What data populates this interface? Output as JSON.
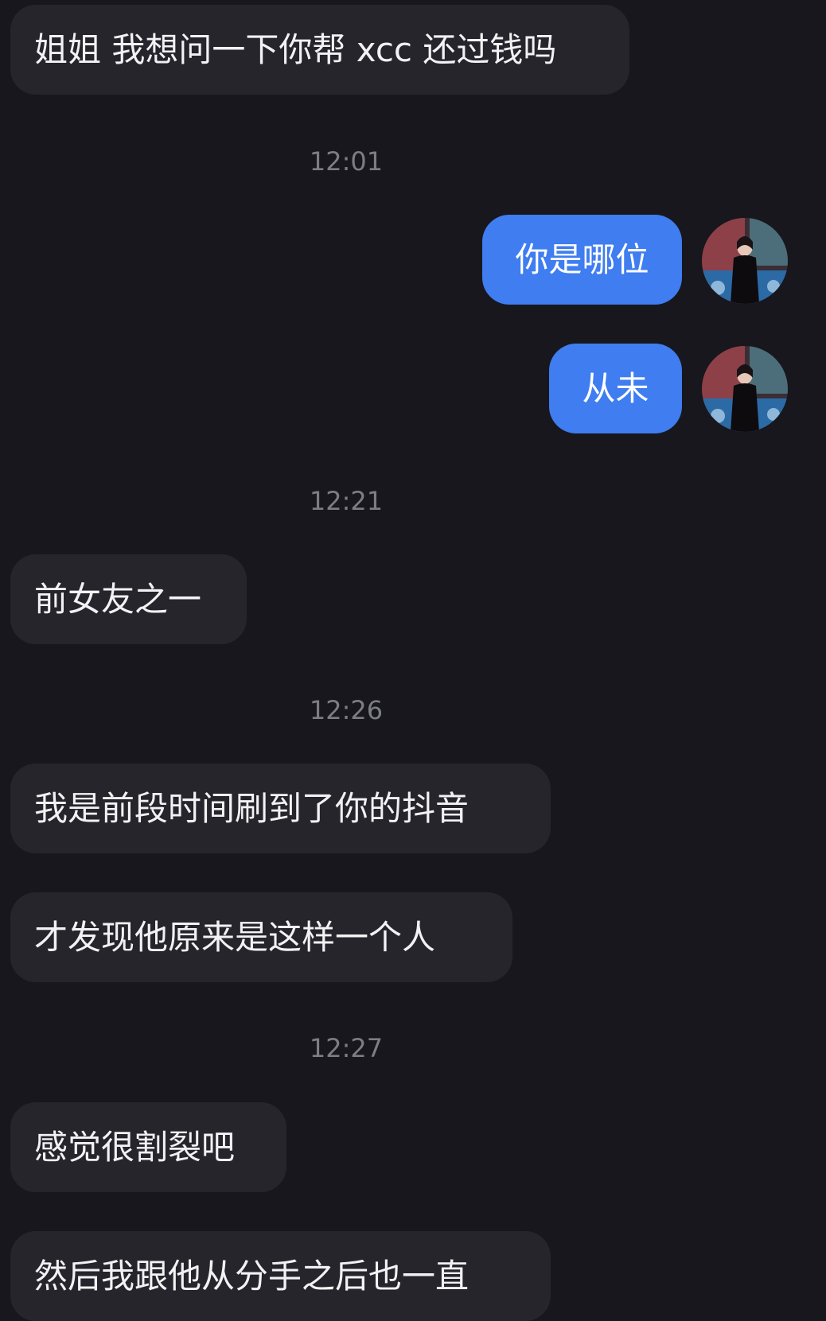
{
  "conversation": {
    "messages": [
      {
        "sender": "contact",
        "text": "姐姐 我想问一下你帮 xcc 还过钱吗"
      },
      {
        "type": "timestamp",
        "text": "12:01"
      },
      {
        "sender": "me",
        "text": "你是哪位"
      },
      {
        "sender": "me",
        "text": "从未"
      },
      {
        "type": "timestamp",
        "text": "12:21"
      },
      {
        "sender": "contact",
        "text": "前女友之一"
      },
      {
        "type": "timestamp",
        "text": "12:26"
      },
      {
        "sender": "contact",
        "text": "我是前段时间刷到了你的抖音"
      },
      {
        "sender": "contact",
        "text": "才发现他原来是这样一个人"
      },
      {
        "type": "timestamp",
        "text": "12:27"
      },
      {
        "sender": "contact",
        "text": "感觉很割裂吧"
      },
      {
        "sender": "contact",
        "text": "然后我跟他从分手之后也一直"
      }
    ]
  },
  "theme": {
    "background": "#17171d",
    "incoming_bubble": "#25252b",
    "outgoing_bubble": "#3f7df0",
    "timestamp_color": "#7d7d84"
  },
  "avatar_icon": "user-avatar-photo"
}
